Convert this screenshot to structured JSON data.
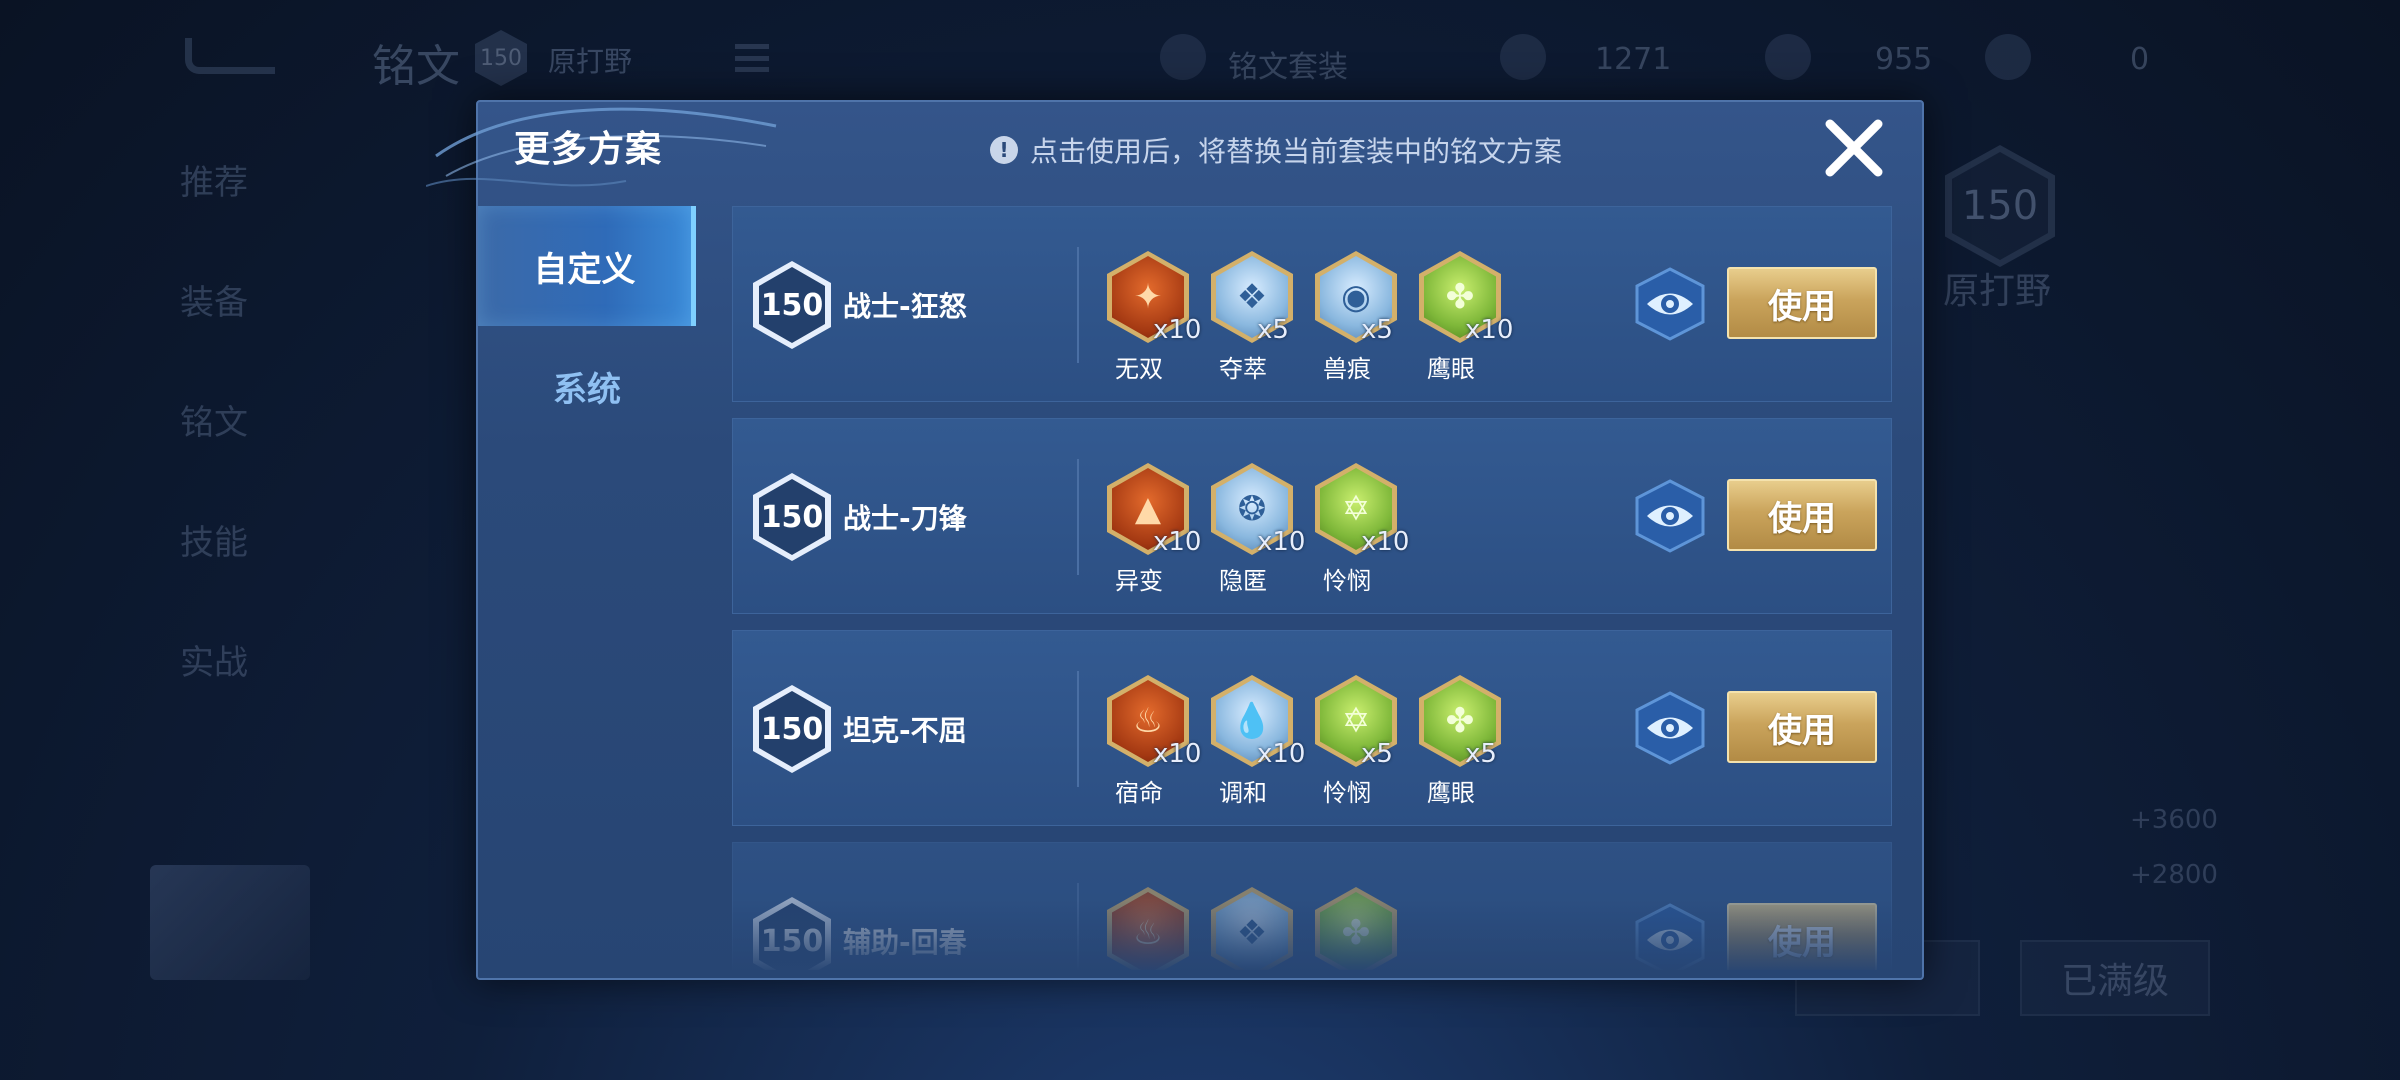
{
  "background": {
    "title": "铭文",
    "level": "150",
    "subtitle": "原打野",
    "resources": [
      {
        "icon": "rune-book-icon",
        "value": "铭文套装"
      },
      {
        "icon": "crystal-icon",
        "value": "1271"
      },
      {
        "icon": "coin-icon",
        "value": "955"
      },
      {
        "icon": "gift-icon",
        "value": "0"
      }
    ],
    "side_items": [
      "推荐",
      "装备",
      "铭文",
      "技能",
      "实战"
    ],
    "right_level": "150",
    "right_label": "原打野",
    "bottom_buttons": [
      "已满级"
    ],
    "small_values": [
      "+3600",
      "+2800"
    ]
  },
  "modal": {
    "title": "更多方案",
    "notice": "点击使用后，将替换当前套装中的铭文方案",
    "tabs": [
      {
        "label": "自定义",
        "active": true
      },
      {
        "label": "系统",
        "active": false
      }
    ],
    "plans": [
      {
        "level": "150",
        "name": "战士-狂怒",
        "runes": [
          {
            "name": "无双",
            "count": "x10",
            "color": "red",
            "glyph": "✦"
          },
          {
            "name": "夺萃",
            "count": "x5",
            "color": "blue",
            "glyph": "❖"
          },
          {
            "name": "兽痕",
            "count": "x5",
            "color": "blue",
            "glyph": "◉"
          },
          {
            "name": "鹰眼",
            "count": "x10",
            "color": "green",
            "glyph": "✤"
          }
        ],
        "use_label": "使用"
      },
      {
        "level": "150",
        "name": "战士-刀锋",
        "runes": [
          {
            "name": "异变",
            "count": "x10",
            "color": "red",
            "glyph": "▲"
          },
          {
            "name": "隐匿",
            "count": "x10",
            "color": "blue",
            "glyph": "❂"
          },
          {
            "name": "怜悯",
            "count": "x10",
            "color": "green",
            "glyph": "✡"
          }
        ],
        "use_label": "使用"
      },
      {
        "level": "150",
        "name": "坦克-不屈",
        "runes": [
          {
            "name": "宿命",
            "count": "x10",
            "color": "red",
            "glyph": "♨"
          },
          {
            "name": "调和",
            "count": "x10",
            "color": "blue",
            "glyph": "💧"
          },
          {
            "name": "怜悯",
            "count": "x5",
            "color": "green",
            "glyph": "✡"
          },
          {
            "name": "鹰眼",
            "count": "x5",
            "color": "green",
            "glyph": "✤"
          }
        ],
        "use_label": "使用"
      },
      {
        "level": "150",
        "name": "辅助-回春",
        "runes": [
          {
            "name": "",
            "count": "",
            "color": "red",
            "glyph": "♨"
          },
          {
            "name": "",
            "count": "",
            "color": "blue",
            "glyph": "❖"
          },
          {
            "name": "",
            "count": "",
            "color": "green",
            "glyph": "✤"
          }
        ],
        "use_label": "使用"
      }
    ]
  },
  "colors": {
    "red": "#b5441e",
    "blue": "#7fb0d8",
    "green": "#7fb83a",
    "gold": "#caa45c",
    "accent": "#7fd0ff"
  }
}
